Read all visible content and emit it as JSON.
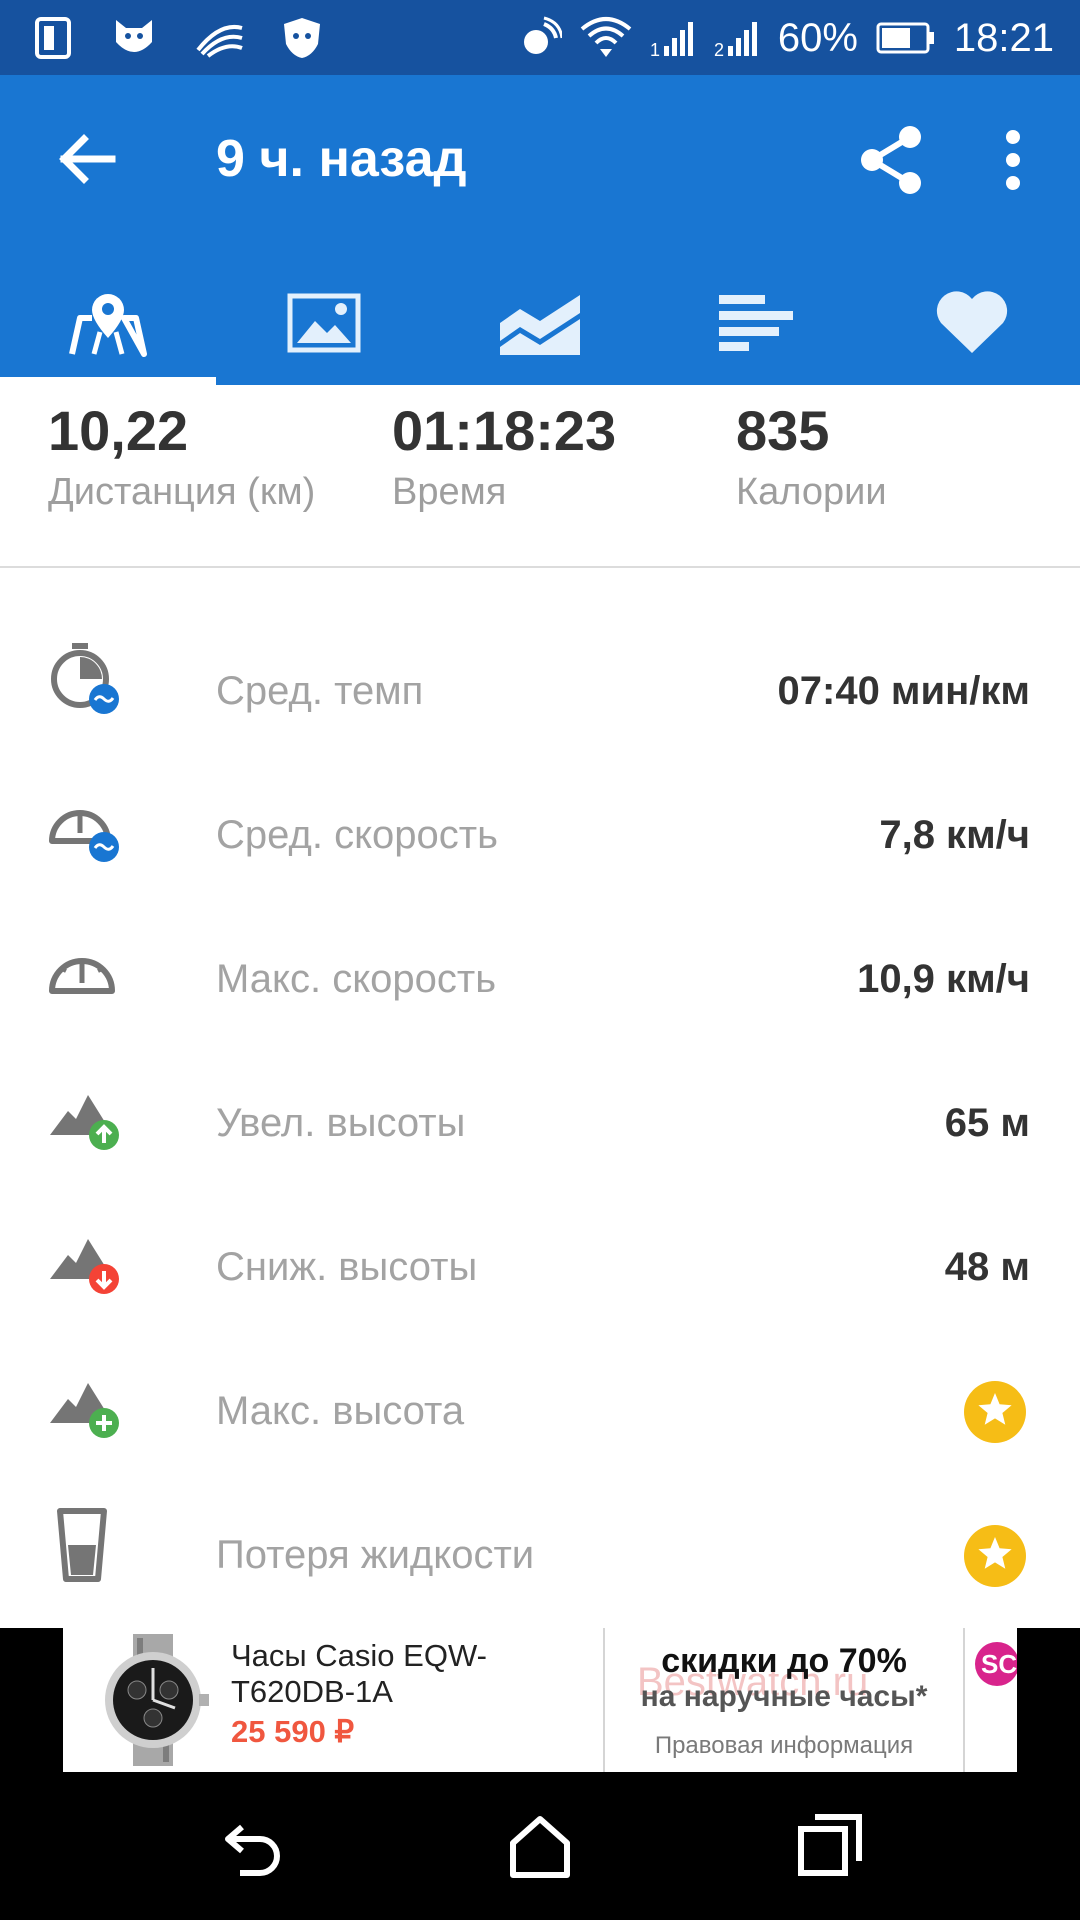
{
  "status_bar": {
    "battery": "60%",
    "time": "18:21",
    "icons": [
      "sim-manager-icon",
      "bird-app-icon",
      "swiftkey-icon",
      "antivirus-icon",
      "nfc-icon",
      "wifi-icon",
      "signal-sim1-icon",
      "signal-sim2-icon",
      "battery-icon"
    ]
  },
  "app_bar": {
    "title": "9 ч. назад",
    "back_icon": "arrow-back-icon",
    "share_icon": "share-icon",
    "more_icon": "more-vertical-icon",
    "color": "#1976d2",
    "status_color": "#16529f"
  },
  "tabs": [
    {
      "icon": "map-pin-icon",
      "active": true
    },
    {
      "icon": "photo-icon",
      "active": false
    },
    {
      "icon": "chart-area-icon",
      "active": false
    },
    {
      "icon": "splits-bars-icon",
      "active": false
    },
    {
      "icon": "heart-icon",
      "active": false
    }
  ],
  "summary": {
    "distance": {
      "value": "10,22",
      "label": "Дистанция (км)"
    },
    "duration": {
      "value": "01:18:23",
      "label": "Время"
    },
    "calories": {
      "value": "835",
      "label": "Калории"
    }
  },
  "stats": [
    {
      "label": "Сред. темп",
      "value": "07:40 мин/км",
      "icon": "avg-pace-icon"
    },
    {
      "label": "Сред. скорость",
      "value": "7,8 км/ч",
      "icon": "avg-speed-icon"
    },
    {
      "label": "Макс. скорость",
      "value": "10,9 км/ч",
      "icon": "max-speed-icon"
    },
    {
      "label": "Увел. высоты",
      "value": "65 м",
      "icon": "elevation-gain-icon"
    },
    {
      "label": "Сниж. высоты",
      "value": "48 м",
      "icon": "elevation-loss-icon"
    },
    {
      "label": "Макс. высота",
      "value": "",
      "icon": "max-elevation-icon",
      "premium": true
    },
    {
      "label": "Потеря жидкости",
      "value": "",
      "icon": "fluid-loss-icon",
      "premium": true
    }
  ],
  "ad": {
    "product": "Часы Casio EQW-T620DB-1A",
    "price": "25 590 ₽",
    "watermark": "Bestwatch.ru",
    "promo_line1": "скидки до 70%",
    "promo_line2": "на наручные часы*",
    "legal": "Правовая информация",
    "next_logo": "SC"
  },
  "nav": {
    "back_icon": "nav-back-icon",
    "home_icon": "nav-home-icon",
    "recents_icon": "nav-recents-icon"
  },
  "colors": {
    "premium_star": "#f6bd16",
    "badge_blue": "#1976d2",
    "badge_green": "#4caf50",
    "badge_red": "#f44336",
    "ad_price": "#f0573f"
  }
}
